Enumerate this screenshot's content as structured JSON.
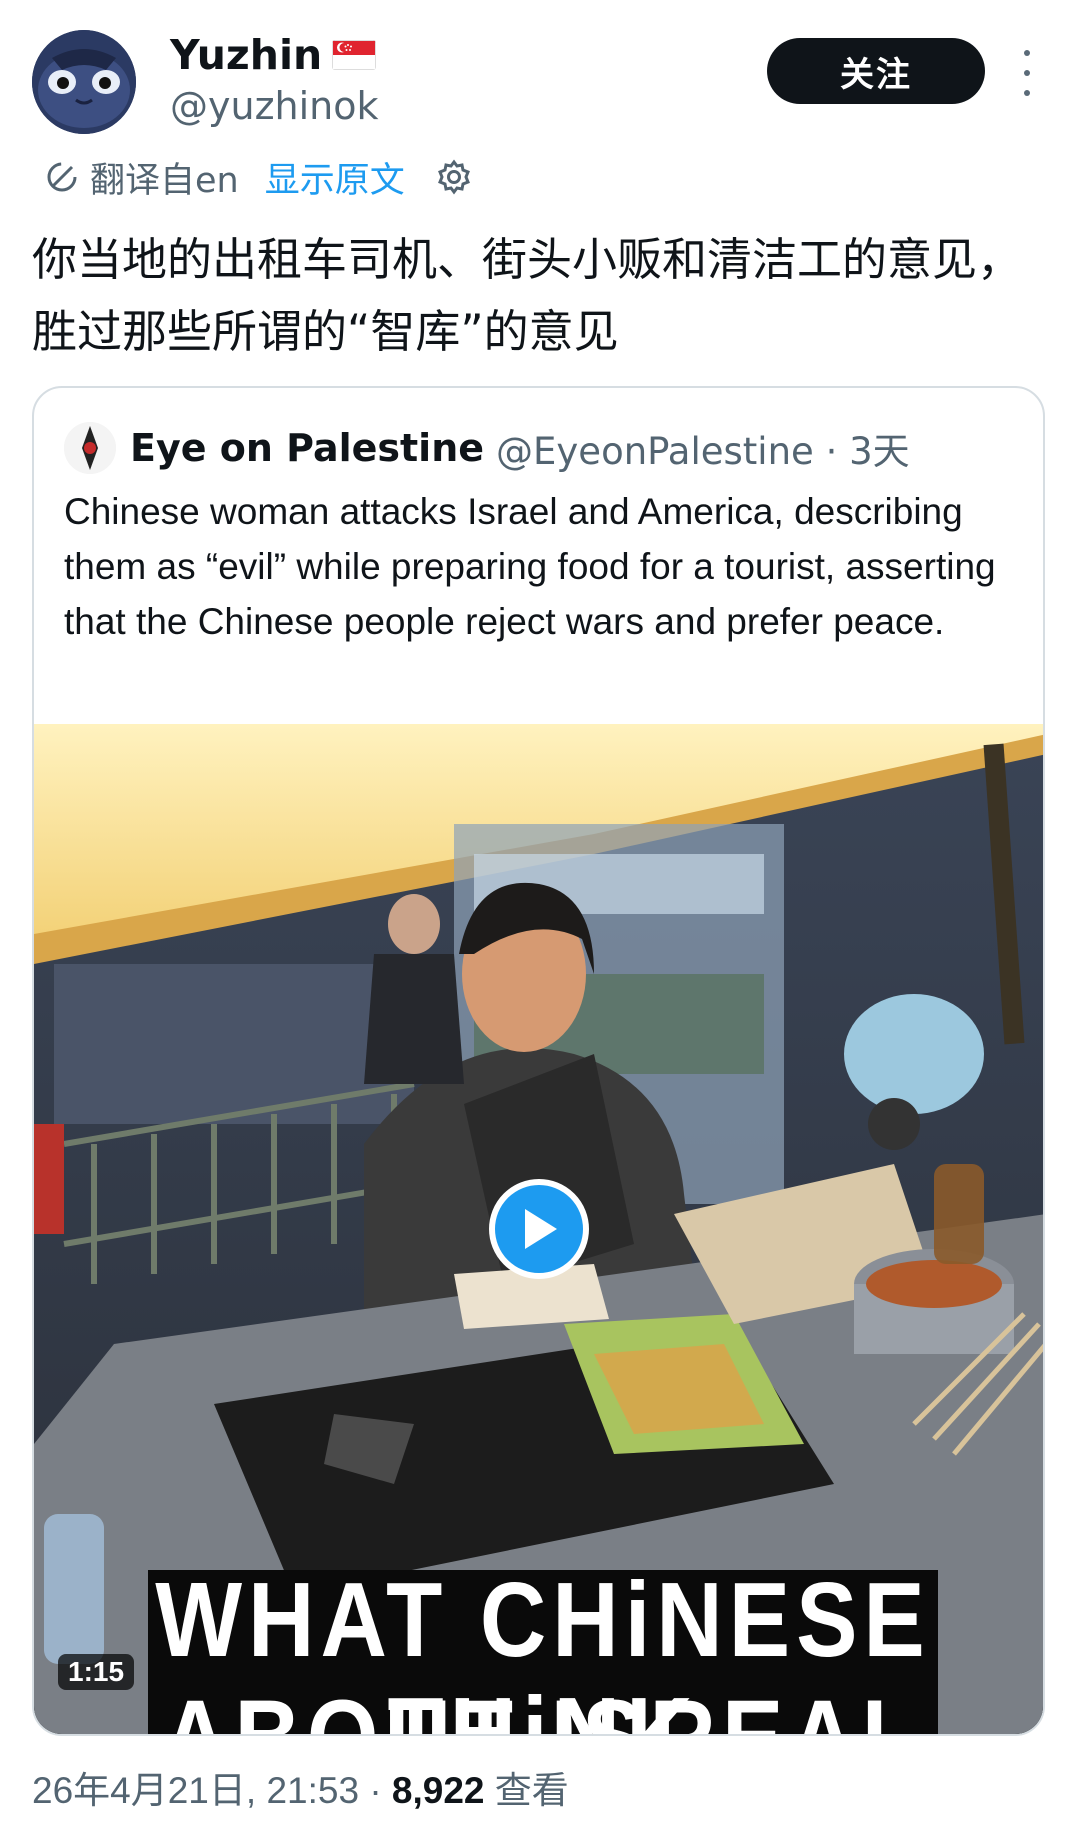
{
  "author": {
    "display_name": "Yuzhin",
    "handle": "@yuzhinok",
    "follow_label": "关注"
  },
  "translation": {
    "translated_from": "翻译自en",
    "show_original": "显示原文"
  },
  "tweet": {
    "text": "你当地的出租车司机、街头小贩和清洁工的意见，胜过那些所谓的“智库”的意见"
  },
  "quoted_tweet": {
    "display_name": "Eye on Palestine",
    "handle_and_time": "@EyeonPalestine · 3天",
    "text": "Chinese woman attacks Israel and America, describing them as “evil” while preparing food for a tourist, asserting that the Chinese people reject wars and prefer peace.",
    "video": {
      "duration": "1:15",
      "caption_line1": "WHAT CHiNESE THiNK",
      "caption_line2": "ABOUT ISREAL",
      "apron_text": "老⽥ 海鲜⼤菜"
    }
  },
  "meta": {
    "timestamp": "26年4月21日, 21:53 · ",
    "views_count": "8,922",
    "views_label": " 查看"
  },
  "colors": {
    "link_blue": "#1d9bf0",
    "text_primary": "#0f1419",
    "text_secondary": "#536471",
    "follow_bg": "#0f1419"
  }
}
